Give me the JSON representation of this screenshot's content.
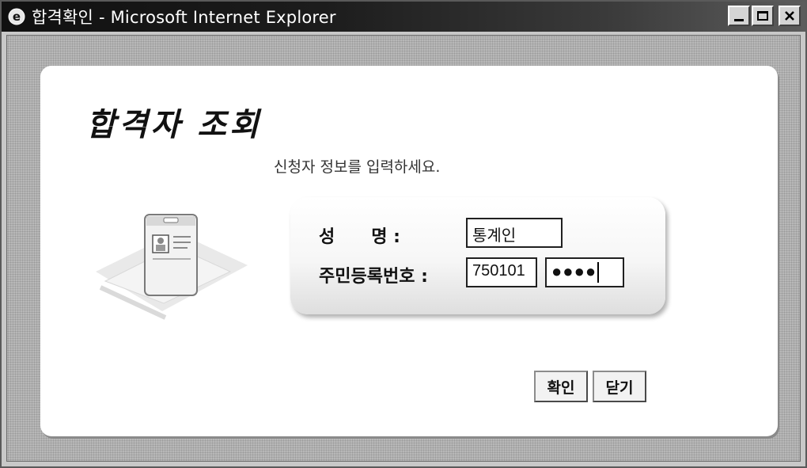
{
  "window": {
    "title": "합격확인 - Microsoft Internet Explorer",
    "controls": {
      "minimize": "_",
      "maximize": "□",
      "close": "×"
    }
  },
  "page": {
    "heading": "합격자 조회",
    "instruction": "신청자 정보를 입력하세요."
  },
  "form": {
    "name_label": "성      명 :",
    "name_value": "통계인",
    "id_label": "주민등록번호 :",
    "id_front_value": "750101",
    "id_back_value": "●●●●"
  },
  "buttons": {
    "confirm": "확인",
    "close": "닫기"
  },
  "icons": {
    "app": "ie-icon",
    "illustration": "id-card-illustration-icon"
  }
}
